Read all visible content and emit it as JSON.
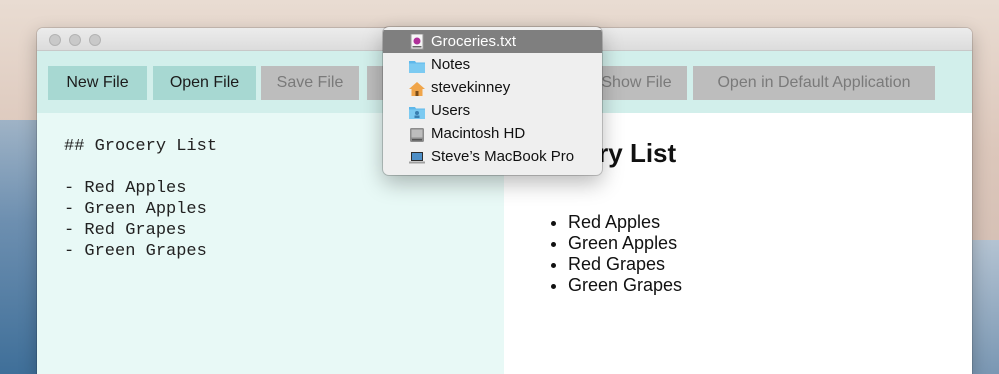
{
  "toolbar": {
    "new_file": "New File",
    "open_file": "Open File",
    "save_file": "Save File",
    "show_file": "Show File",
    "open_default": "Open in Default Application"
  },
  "editor": {
    "content": "## Grocery List\n\n- Red Apples\n- Green Apples\n- Red Grapes\n- Green Grapes"
  },
  "preview": {
    "heading": "Grocery List",
    "items": [
      "Red Apples",
      "Green Apples",
      "Red Grapes",
      "Green Grapes"
    ]
  },
  "path_menu": {
    "items": [
      {
        "label": "Groceries.txt",
        "icon": "text-file-icon"
      },
      {
        "label": "Notes",
        "icon": "folder-icon"
      },
      {
        "label": "stevekinney",
        "icon": "home-icon"
      },
      {
        "label": "Users",
        "icon": "users-folder-icon"
      },
      {
        "label": "Macintosh HD",
        "icon": "hard-drive-icon"
      },
      {
        "label": "Steve’s MacBook Pro",
        "icon": "laptop-icon"
      }
    ],
    "selected_index": 0
  }
}
